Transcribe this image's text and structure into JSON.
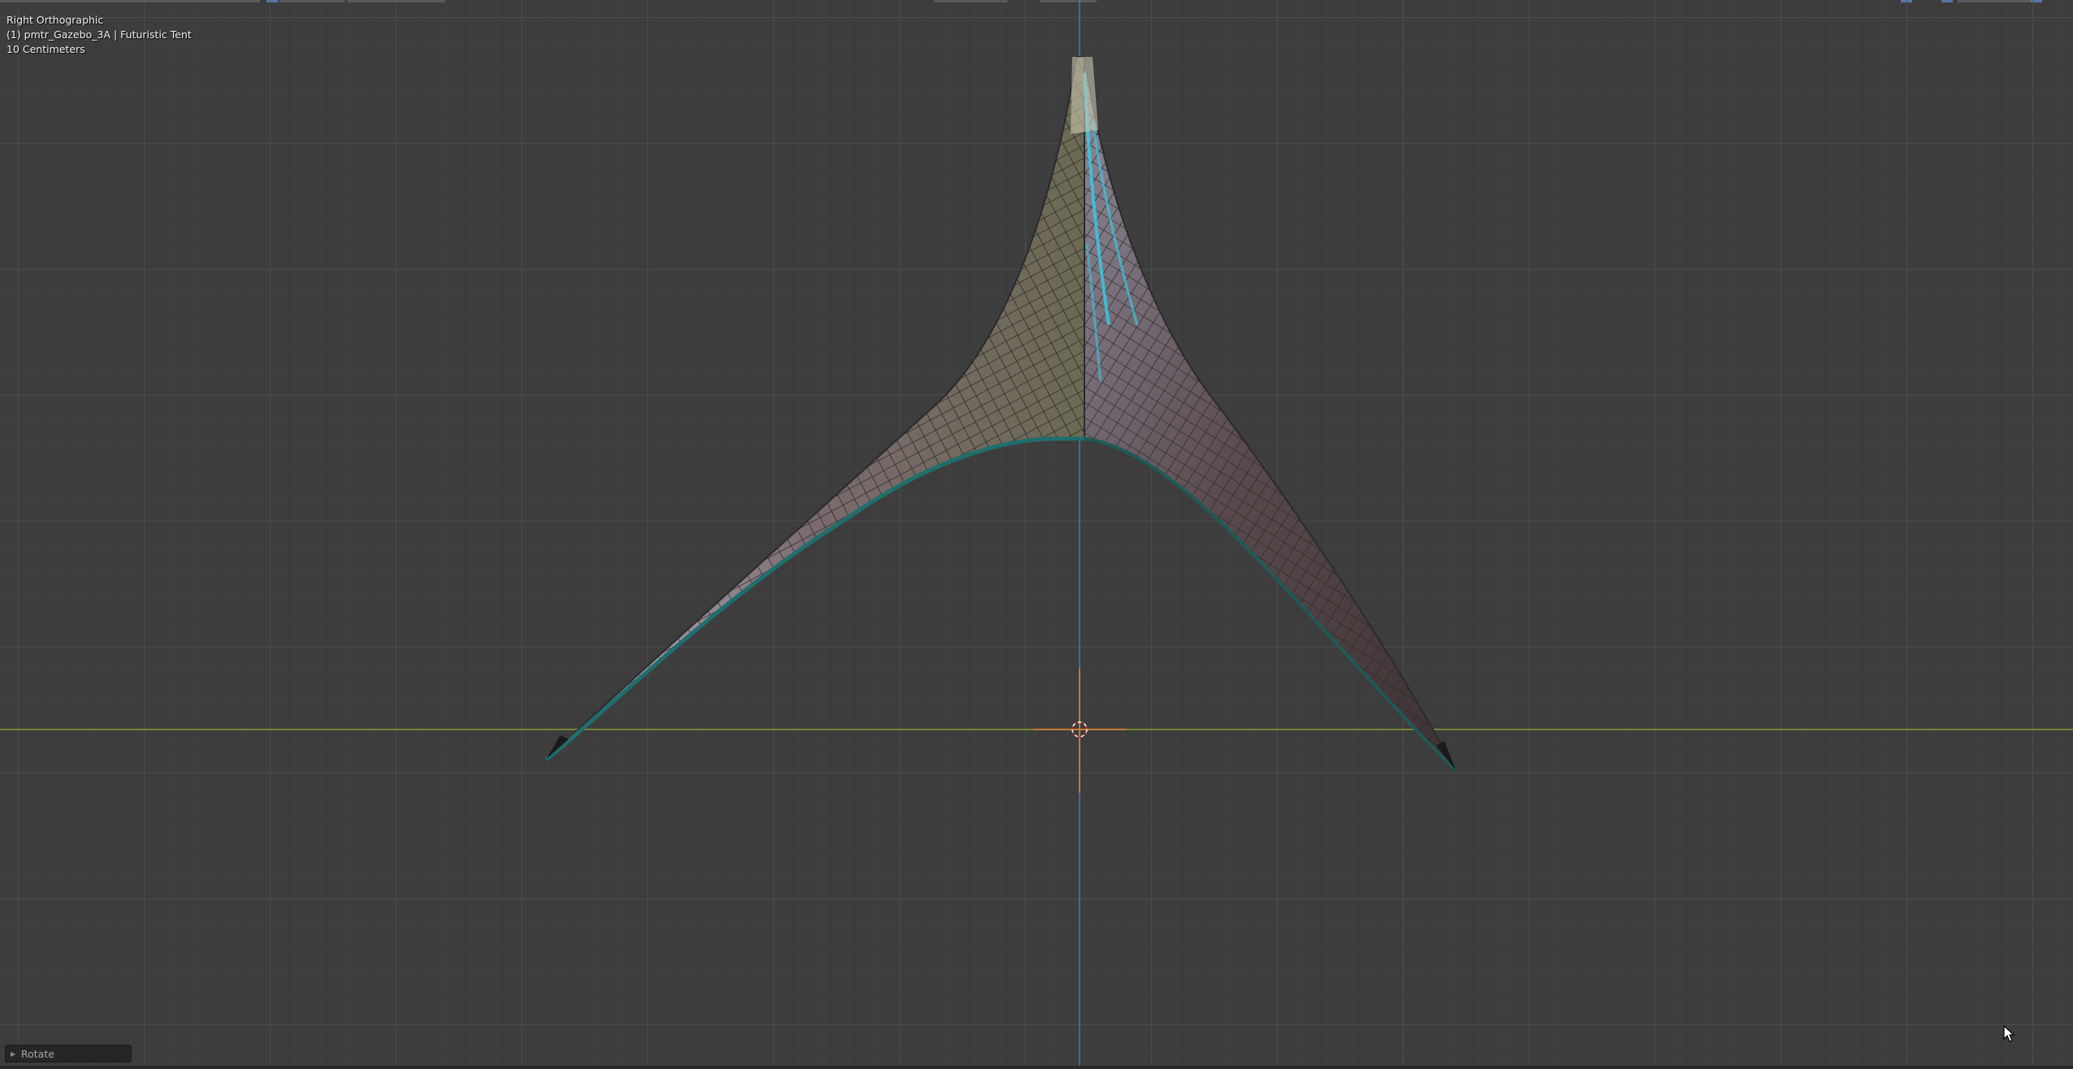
{
  "viewport": {
    "view_name": "Right Orthographic",
    "object_info": "(1) pmtr_Gazebo_3A | Futuristic Tent",
    "grid_scale": "10 Centimeters"
  },
  "operator_panel": {
    "label": "Rotate"
  },
  "colors": {
    "background": "#3d3d3d",
    "grid_minor": "#474747",
    "grid_major": "#545454",
    "horizon_axis": "#8e9a3a",
    "vertical_axis": "#4a78b8",
    "cursor_3d": "#f08030"
  },
  "icons": {
    "cursor": "mouse-pointer-icon",
    "crosshair": "3d-cursor-icon",
    "expand": "triangle-right-icon"
  }
}
